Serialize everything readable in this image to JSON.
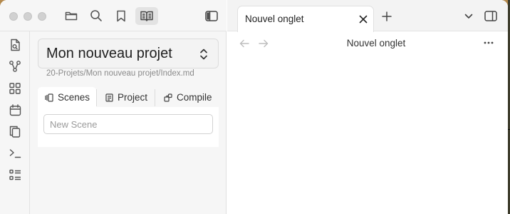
{
  "window": {
    "traffic_lights": [
      "close",
      "minimize",
      "zoom"
    ]
  },
  "toolbar": {
    "icons": [
      "folder-icon",
      "search-icon",
      "bookmark-icon",
      "reading-view-icon",
      "sidebar-toggle-icon"
    ]
  },
  "ribbon": {
    "icons": [
      "open-quick-switcher-icon",
      "graph-view-icon",
      "canvas-icon",
      "daily-notes-icon",
      "copy-icon",
      "terminal-icon",
      "outline-icon"
    ]
  },
  "project": {
    "title": "Mon nouveau projet",
    "path": "20-Projets/Mon nouveau projet/Index.md"
  },
  "tabs": [
    {
      "label": "Scenes",
      "icon": "scenes-icon",
      "active": true
    },
    {
      "label": "Project",
      "icon": "project-icon",
      "active": false
    },
    {
      "label": "Compile",
      "icon": "compile-icon",
      "active": false
    }
  ],
  "scenes": {
    "new_scene_placeholder": "New Scene",
    "new_scene_value": ""
  },
  "editor": {
    "tab_title": "Nouvel onglet",
    "view_title": "Nouvel onglet"
  },
  "colors": {
    "accent_bg": "#e3e3e3",
    "muted_text": "#8a8a8a",
    "wallpaper": "#8f6a35"
  }
}
